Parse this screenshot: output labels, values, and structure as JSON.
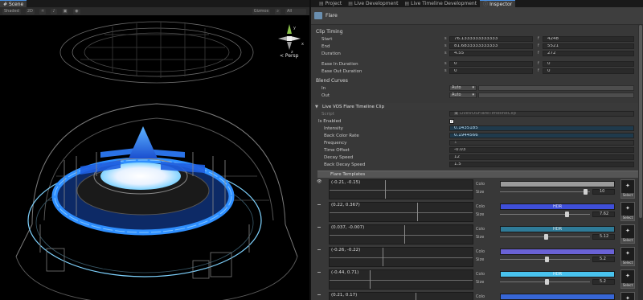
{
  "scene": {
    "tab_label": "Scene",
    "shading_mode": "Shaded",
    "toolbar_2d": "2D",
    "gizmos_label": "Gizmos",
    "search_all": "All",
    "persp_label": "< Persp",
    "gizmo_axes": {
      "y": "y",
      "x": "x",
      "z": "z"
    }
  },
  "panel_tabs": [
    {
      "label": "Project"
    },
    {
      "label": "Live Development"
    },
    {
      "label": "Live Timeline Development"
    },
    {
      "label": "Inspector",
      "active": true
    }
  ],
  "inspector": {
    "header_title": "Flare",
    "clip_timing": {
      "title": "Clip Timing",
      "rows": [
        {
          "label": "Start",
          "seconds_prefix": "s",
          "seconds": "76.1333333333333",
          "frames_prefix": "f",
          "frames": "4248"
        },
        {
          "label": "End",
          "seconds_prefix": "s",
          "seconds": "81.6833333333333",
          "frames_prefix": "f",
          "frames": "5521"
        },
        {
          "label": "Duration",
          "seconds_prefix": "s",
          "seconds": "4.55",
          "frames_prefix": "f",
          "frames": "272"
        },
        {
          "label": "Ease In Duration",
          "seconds_prefix": "s",
          "seconds": "0",
          "frames_prefix": "f",
          "frames": "0"
        },
        {
          "label": "Ease Out Duration",
          "seconds_prefix": "s",
          "seconds": "0",
          "frames_prefix": "f",
          "frames": "0"
        }
      ]
    },
    "blend_curves": {
      "title": "Blend Curves",
      "rows": [
        {
          "label": "In",
          "mode": "Auto"
        },
        {
          "label": "Out",
          "mode": "Auto"
        }
      ]
    },
    "clip": {
      "title": "Live VOS Flare Timeline Clip",
      "script_label": "Script",
      "script_value": "LiveVOSFlareTimelineClip",
      "is_enabled_label": "Is Enabled",
      "is_enabled_checked": true,
      "props": [
        {
          "label": "Intensity",
          "value": "0.1435185",
          "highlight": true
        },
        {
          "label": "Back Color Rate",
          "value": "0.1944566",
          "highlight": true
        },
        {
          "label": "Frequency",
          "value": "1",
          "dim": true
        },
        {
          "label": "Time Offset",
          "value": "-0.03",
          "highlight": false
        },
        {
          "label": "Decay Speed",
          "value": "12",
          "highlight": false
        },
        {
          "label": "Back Decay Speed",
          "value": "1.5",
          "highlight": false
        }
      ],
      "templates_title": "Flare Templates",
      "templates": [
        {
          "coord": "(-0.21, -0.15)",
          "color": "#9b9b9b",
          "hdr": "",
          "size": "10",
          "size_frac": 0.97,
          "vline_frac": 0.39,
          "eye": true
        },
        {
          "coord": "(0.22, 0.367)",
          "color": "#3f4fd9",
          "hdr": "HDR",
          "size": "7.62",
          "size_frac": 0.76,
          "vline_frac": 0.61,
          "eye": false
        },
        {
          "coord": "(0.037, -0.007)",
          "color": "#2f7b98",
          "hdr": "HDR",
          "size": "5.12",
          "size_frac": 0.51,
          "vline_frac": 0.52,
          "eye": false
        },
        {
          "coord": "(-0.26, -0.22)",
          "color": "#6a62d6",
          "hdr": "",
          "size": "5.2",
          "size_frac": 0.52,
          "vline_frac": 0.37,
          "eye": false
        },
        {
          "coord": "(-0.44, 0.71)",
          "color": "#49c3ee",
          "hdr": "HDR",
          "size": "5.2",
          "size_frac": 0.52,
          "vline_frac": 0.28,
          "eye": false
        },
        {
          "coord": "(0.21, 0.17)",
          "color": "#3766d6",
          "hdr": "",
          "size": "",
          "size_frac": 0.5,
          "vline_frac": 0.6,
          "eye": false
        }
      ],
      "color_label": "Colo",
      "size_label": "Size",
      "select_label": "Select"
    }
  },
  "colors": {
    "accent_blue": "#4a90e2",
    "stage_blue": "#2f8fff",
    "light_cyan": "#7fd3ff"
  },
  "icons": [
    "search-icon",
    "eye-icon",
    "drag-handle-icon",
    "flare-texture-icon",
    "checkmark-icon",
    "foldout-arrow-icon"
  ]
}
